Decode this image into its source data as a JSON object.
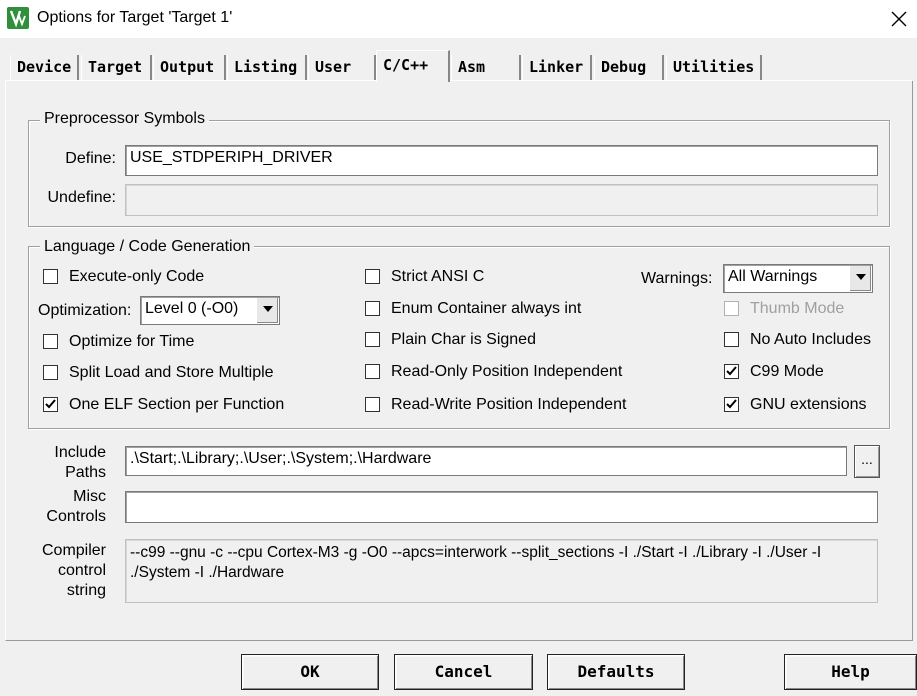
{
  "window": {
    "title": "Options for Target 'Target 1'",
    "icon": "keil-uvision-icon",
    "close_icon": "close-icon"
  },
  "tabs": [
    {
      "label": "Device"
    },
    {
      "label": "Target"
    },
    {
      "label": "Output"
    },
    {
      "label": "Listing"
    },
    {
      "label": "User"
    },
    {
      "label": "C/C++",
      "active": true
    },
    {
      "label": "Asm"
    },
    {
      "label": "Linker"
    },
    {
      "label": "Debug"
    },
    {
      "label": "Utilities"
    }
  ],
  "preprocessor": {
    "legend": "Preprocessor Symbols",
    "define_label": "Define:",
    "define_value": "USE_STDPERIPH_DRIVER",
    "undefine_label": "Undefine:",
    "undefine_value": ""
  },
  "codegen": {
    "legend": "Language / Code Generation",
    "execute_only": {
      "label": "Execute-only Code",
      "checked": false
    },
    "optimization_label": "Optimization:",
    "optimization_value": "Level 0 (-O0)",
    "optimize_time": {
      "label": "Optimize for Time",
      "checked": false
    },
    "split_load": {
      "label": "Split Load and Store Multiple",
      "checked": false
    },
    "one_elf": {
      "label": "One ELF Section per Function",
      "checked": true
    },
    "strict_ansi": {
      "label": "Strict ANSI C",
      "checked": false
    },
    "enum_container": {
      "label": "Enum Container always int",
      "checked": false
    },
    "plain_char": {
      "label": "Plain Char is Signed",
      "checked": false
    },
    "ro_pi": {
      "label": "Read-Only Position Independent",
      "checked": false
    },
    "rw_pi": {
      "label": "Read-Write Position Independent",
      "checked": false
    },
    "warnings_label": "Warnings:",
    "warnings_value": "All Warnings",
    "thumb_mode": {
      "label": "Thumb Mode",
      "checked": false,
      "disabled": true
    },
    "no_auto_includes": {
      "label": "No Auto Includes",
      "checked": false
    },
    "c99_mode": {
      "label": "C99 Mode",
      "checked": true
    },
    "gnu_ext": {
      "label": "GNU extensions",
      "checked": true
    }
  },
  "paths": {
    "include_label_1": "Include",
    "include_label_2": "Paths",
    "include_value": ".\\Start;.\\Library;.\\User;.\\System;.\\Hardware",
    "browse_label": "...",
    "misc_label_1": "Misc",
    "misc_label_2": "Controls",
    "misc_value": "",
    "compiler_label_1": "Compiler",
    "compiler_label_2": "control",
    "compiler_label_3": "string",
    "compiler_value": "--c99 --gnu -c --cpu Cortex-M3 -g -O0 --apcs=interwork --split_sections -I ./Start -I ./Library -I ./User -I ./System -I ./Hardware"
  },
  "buttons": {
    "ok": "OK",
    "cancel": "Cancel",
    "defaults": "Defaults",
    "help": "Help"
  }
}
